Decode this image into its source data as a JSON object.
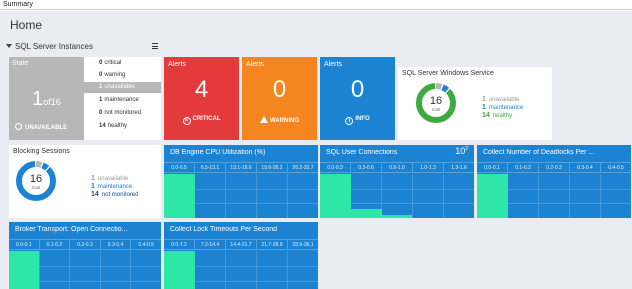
{
  "window": {
    "title": "Summary"
  },
  "page": {
    "title": "Home"
  },
  "section": {
    "label": "SQL Server Instances"
  },
  "state": {
    "title": "State",
    "count": "1",
    "of_total": "of16",
    "footer": "UNAVAILABLE",
    "rows": [
      {
        "count": "0",
        "label": "critical"
      },
      {
        "count": "0",
        "label": "warning"
      },
      {
        "count": "1",
        "label": "unavailable"
      },
      {
        "count": "1",
        "label": "maintenance"
      },
      {
        "count": "0",
        "label": "not monitored"
      },
      {
        "count": "14",
        "label": "healthy"
      }
    ]
  },
  "alerts": [
    {
      "title": "Alerts",
      "count": "4",
      "footer": "CRITICAL",
      "color": "#e33b3b"
    },
    {
      "title": "Alerts",
      "count": "0",
      "footer": "WARNING",
      "color": "#f5861f"
    },
    {
      "title": "Alerts",
      "count": "0",
      "footer": "INFO",
      "color": "#1b83d2"
    }
  ],
  "sql_service": {
    "title": "SQL Server Windows Service",
    "total": "16",
    "total_label": "total",
    "legend": [
      {
        "count": "1",
        "label": "unavailable"
      },
      {
        "count": "1",
        "label": "maintenance"
      },
      {
        "count": "14",
        "label": "healthy"
      }
    ],
    "segments": [
      {
        "value": 1,
        "color": "#b7b7b7"
      },
      {
        "value": 1,
        "color": "#1b83d2"
      },
      {
        "value": 14,
        "color": "#3daa3d"
      }
    ]
  },
  "blocking": {
    "title": "Blocking Sessions",
    "total": "16",
    "total_label": "total",
    "legend": [
      {
        "count": "1",
        "label": "unavailable"
      },
      {
        "count": "1",
        "label": "maintenance"
      },
      {
        "count": "14",
        "label": "not monitored"
      }
    ],
    "segments": [
      {
        "value": 1,
        "color": "#b7b7b7"
      },
      {
        "value": 1,
        "color": "#1b83d2"
      },
      {
        "value": 14,
        "color": "#1b83d2"
      }
    ]
  },
  "histograms": {
    "cpu": {
      "title": "DB Engine CPU Utilization (%)",
      "bins": [
        "0.0-6.5",
        "6.5-13.1",
        "13.1-19.6",
        "19.6-26.2",
        "26.2-32.7"
      ],
      "values": [
        1.0,
        0,
        0,
        0,
        0
      ]
    },
    "conn": {
      "title": "SQL User Connections",
      "multiplier": "10",
      "exponent": "2",
      "bins": [
        "0.0-0.3",
        "0.3-0.6",
        "0.6-1.0",
        "1.0-1.3",
        "1.3-1.6"
      ],
      "values": [
        1.0,
        0.2,
        0.07,
        0,
        0
      ]
    },
    "dead": {
      "title": "Collect Number of Deadlocks Per ...",
      "bins": [
        "0.0-0.1",
        "0.1-0.2",
        "0.2-0.3",
        "0.3-0.4",
        "0.4-0.5"
      ],
      "values": [
        1.0,
        0,
        0,
        0,
        0
      ]
    },
    "broker": {
      "title": "Broker Transport: Open Connectio...",
      "bins": [
        "0.0-0.1",
        "0.1-0.2",
        "0.2-0.3",
        "0.3-0.4",
        "0.4-0.5"
      ],
      "values": [
        1.0,
        0,
        0,
        0,
        0
      ]
    },
    "lock": {
      "title": "Collect Lock Timeouts Per Second",
      "bins": [
        "0.0-7.2",
        "7.2-14.4",
        "14.4-21.7",
        "21.7-28.9",
        "28.9-36.1"
      ],
      "values": [
        1.0,
        0,
        0,
        0,
        0
      ]
    }
  }
}
